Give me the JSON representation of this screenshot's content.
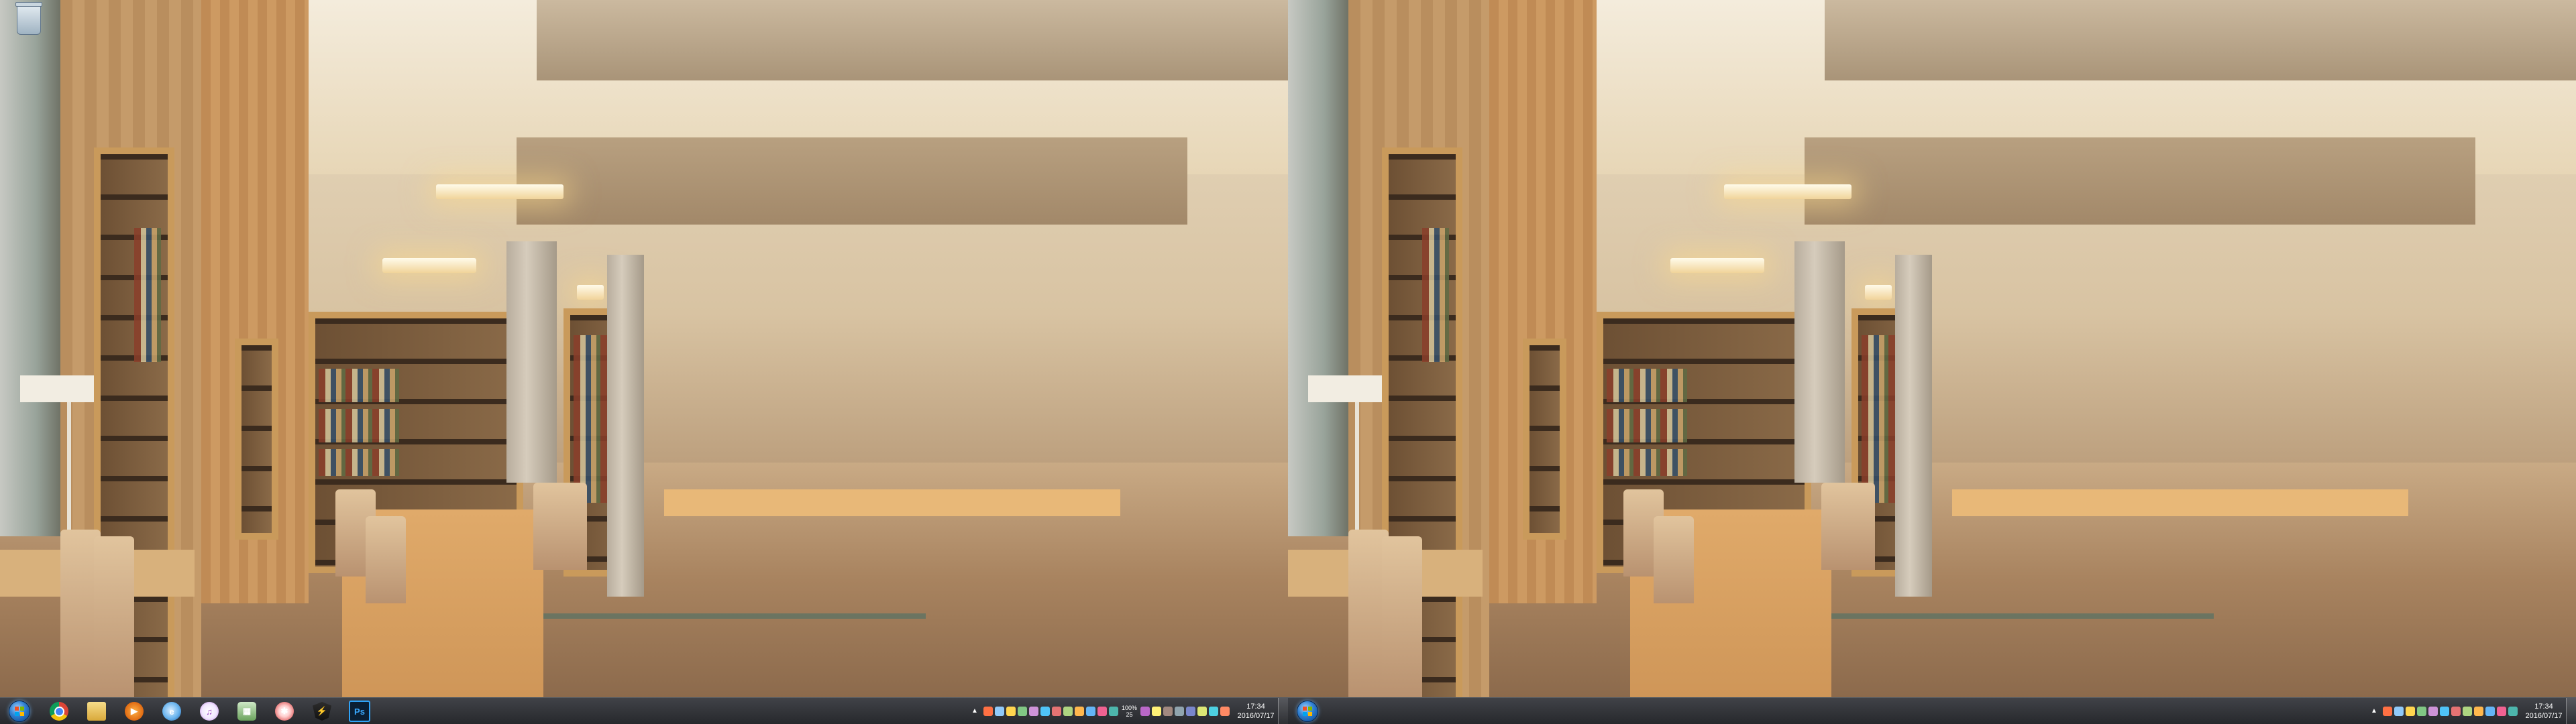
{
  "desktop": {
    "icons": [
      {
        "name": "Recycle Bin",
        "icon": "recycle-bin-icon"
      }
    ]
  },
  "taskbar_left": {
    "start_icon": "windows-start-orb",
    "pinned": [
      {
        "icon": "chrome-icon",
        "glyph": ""
      },
      {
        "icon": "file-explorer-icon",
        "glyph": ""
      },
      {
        "icon": "media-player-icon",
        "glyph": "▶"
      },
      {
        "icon": "internet-explorer-icon",
        "glyph": "e"
      },
      {
        "icon": "itunes-icon",
        "glyph": "♫"
      },
      {
        "icon": "calculator-icon",
        "glyph": "▦"
      },
      {
        "icon": "bug-app-icon",
        "glyph": "✱"
      },
      {
        "icon": "shield-app-icon",
        "glyph": "⚡"
      },
      {
        "icon": "photoshop-icon",
        "glyph": "Ps"
      }
    ]
  },
  "taskbar_right": {
    "start_icon": "windows-start-orb"
  },
  "tray_left": {
    "chevron": "▲",
    "status_lines": [
      "100%",
      "25"
    ],
    "icon_colors": [
      "#ff7043",
      "#90caf9",
      "#ffd54f",
      "#81c784",
      "#ce93d8",
      "#4fc3f7",
      "#e57373",
      "#aed581",
      "#ffb74d",
      "#64b5f6",
      "#f06292",
      "#4db6ac",
      "#ba68c8",
      "#fff176",
      "#a1887f",
      "#90a4ae",
      "#7986cb",
      "#dce775",
      "#4dd0e1",
      "#ff8a65"
    ],
    "clock_time": "17:34",
    "clock_date": "2016/07/17"
  },
  "tray_right": {
    "chevron": "▲",
    "icon_colors": [
      "#ff7043",
      "#90caf9",
      "#ffd54f",
      "#81c784",
      "#ce93d8",
      "#4fc3f7",
      "#e57373",
      "#aed581",
      "#ffb74d",
      "#64b5f6",
      "#f06292",
      "#4db6ac"
    ],
    "clock_time": "17:34",
    "clock_date": "2016/07/17"
  }
}
